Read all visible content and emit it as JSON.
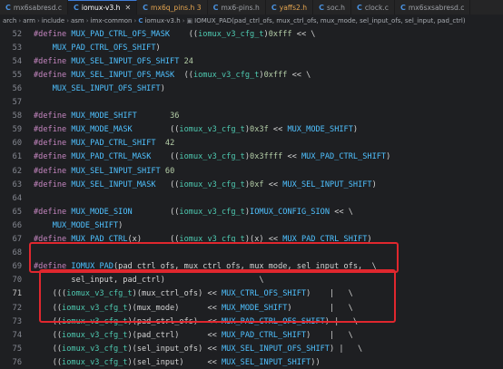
{
  "tabs": [
    {
      "label": "mx6sabresd.c",
      "active": false,
      "dirty": false
    },
    {
      "label": "iomux-v3.h",
      "active": true,
      "dirty": false
    },
    {
      "label": "mx6q_pins.h 3",
      "active": false,
      "dirty": true
    },
    {
      "label": "mx6-pins.h",
      "active": false,
      "dirty": false
    },
    {
      "label": "yaffs2.h",
      "active": false,
      "dirty": true
    },
    {
      "label": "soc.h",
      "active": false,
      "dirty": false
    },
    {
      "label": "clock.c",
      "active": false,
      "dirty": false
    },
    {
      "label": "mx6sxsabresd.c",
      "active": false,
      "dirty": false
    }
  ],
  "breadcrumb": {
    "parts": [
      "arch",
      "arm",
      "include",
      "asm",
      "imx-common"
    ],
    "file": "iomux-v3.h",
    "symbol": "IOMUX_PAD(pad_ctrl_ofs, mux_ctrl_ofs, mux_mode, sel_input_ofs, sel_input, pad_ctrl)"
  },
  "lines": [
    {
      "n": "52",
      "text": "#define MUX_PAD_CTRL_OFS_MASK    ((iomux_v3_cfg_t)0xfff << \\"
    },
    {
      "n": "53",
      "text": "    MUX_PAD_CTRL_OFS_SHIFT)"
    },
    {
      "n": "54",
      "text": "#define MUX_SEL_INPUT_OFS_SHIFT 24"
    },
    {
      "n": "55",
      "text": "#define MUX_SEL_INPUT_OFS_MASK  ((iomux_v3_cfg_t)0xfff << \\"
    },
    {
      "n": "56",
      "text": "    MUX_SEL_INPUT_OFS_SHIFT)"
    },
    {
      "n": "57",
      "text": ""
    },
    {
      "n": "58",
      "text": "#define MUX_MODE_SHIFT       36"
    },
    {
      "n": "59",
      "text": "#define MUX_MODE_MASK        ((iomux_v3_cfg_t)0x3f << MUX_MODE_SHIFT)"
    },
    {
      "n": "60",
      "text": "#define MUX_PAD_CTRL_SHIFT  42"
    },
    {
      "n": "61",
      "text": "#define MUX_PAD_CTRL_MASK    ((iomux_v3_cfg_t)0x3ffff << MUX_PAD_CTRL_SHIFT)"
    },
    {
      "n": "62",
      "text": "#define MUX_SEL_INPUT_SHIFT 60"
    },
    {
      "n": "63",
      "text": "#define MUX_SEL_INPUT_MASK   ((iomux_v3_cfg_t)0xf << MUX_SEL_INPUT_SHIFT)"
    },
    {
      "n": "64",
      "text": ""
    },
    {
      "n": "65",
      "text": "#define MUX_MODE_SION        ((iomux_v3_cfg_t)IOMUX_CONFIG_SION << \\"
    },
    {
      "n": "66",
      "text": "    MUX_MODE_SHIFT)"
    },
    {
      "n": "67",
      "text": "#define MUX_PAD_CTRL(x)      ((iomux_v3_cfg_t)(x) << MUX_PAD_CTRL_SHIFT)"
    },
    {
      "n": "68",
      "text": ""
    },
    {
      "n": "69",
      "text": "#define IOMUX_PAD(pad_ctrl_ofs, mux_ctrl_ofs, mux_mode, sel_input_ofs,  \\"
    },
    {
      "n": "70",
      "text": "        sel_input, pad_ctrl)                    \\"
    },
    {
      "n": "71",
      "text": "    (((iomux_v3_cfg_t)(mux_ctrl_ofs) << MUX_CTRL_OFS_SHIFT)    |   \\"
    },
    {
      "n": "72",
      "text": "    ((iomux_v3_cfg_t)(mux_mode)      << MUX_MODE_SHIFT)        |   \\"
    },
    {
      "n": "73",
      "text": "    ((iomux_v3_cfg_t)(pad_ctrl_ofs)  << MUX_PAD_CTRL_OFS_SHIFT) |   \\"
    },
    {
      "n": "74",
      "text": "    ((iomux_v3_cfg_t)(pad_ctrl)      << MUX_PAD_CTRL_SHIFT)    |   \\"
    },
    {
      "n": "75",
      "text": "    ((iomux_v3_cfg_t)(sel_input_ofs) << MUX_SEL_INPUT_OFS_SHIFT) |   \\"
    },
    {
      "n": "76",
      "text": "    ((iomux_v3_cfg_t)(sel_input)     << MUX_SEL_INPUT_SHIFT))"
    }
  ],
  "colors": {
    "background": "#1e1f22",
    "keyword": "#c586c0",
    "macro": "#4fc1ff",
    "number": "#b5cea8",
    "type": "#4ec9b0",
    "text": "#d4d4d4",
    "line_number": "#858891",
    "highlight_box": "#e0272e",
    "tab_accent": "#3d7bd6"
  }
}
